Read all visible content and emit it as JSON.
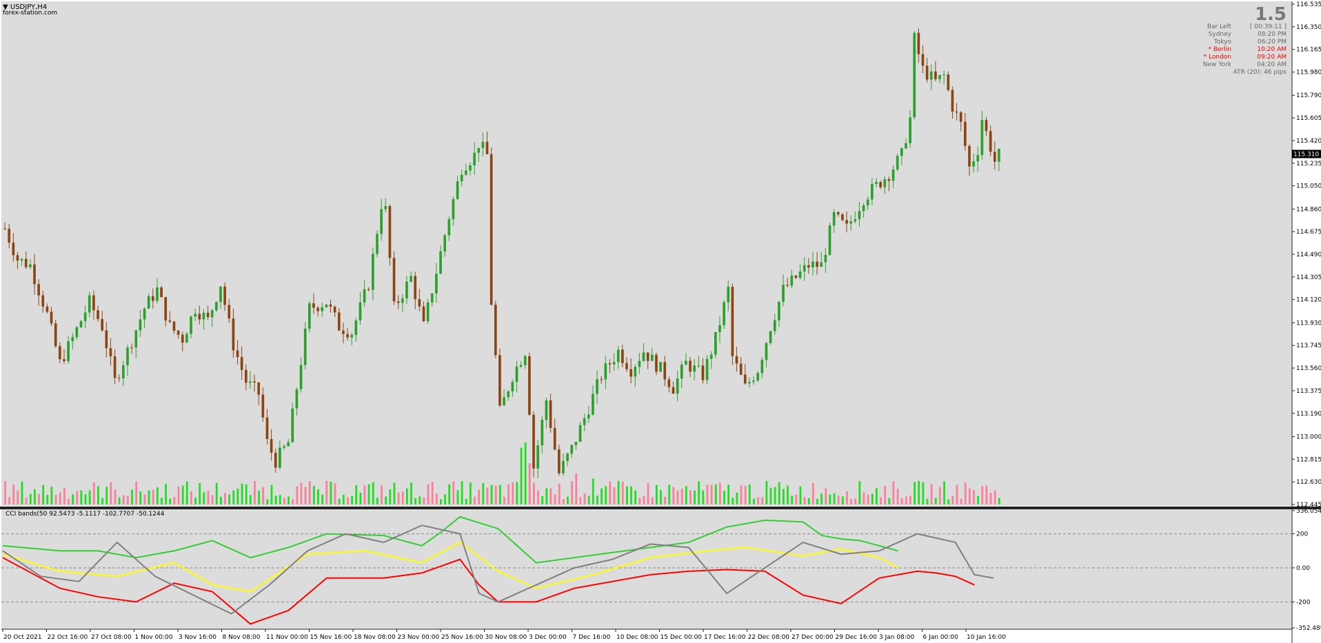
{
  "window": {
    "title": "USDJPY,H4",
    "subtitle": "forex-station.com"
  },
  "info": {
    "spread": "1.5",
    "rows": [
      {
        "label": "Bar Left",
        "value": "[ 00:39:11 ]",
        "highlight": false
      },
      {
        "label": "Sydney",
        "value": "08:20 PM",
        "highlight": false
      },
      {
        "label": "Tokyo",
        "value": "06:20 PM",
        "highlight": false
      },
      {
        "label": "* Berlin",
        "value": "10:20 AM",
        "highlight": true
      },
      {
        "label": "* London",
        "value": "09:20 AM",
        "highlight": true
      },
      {
        "label": "New York",
        "value": "04:20 AM",
        "highlight": false
      }
    ],
    "atr": "ATR (20): 46 pips"
  },
  "indicator": {
    "label": "CCI bands(50 92.5473 -5.1117 -102.7707 -50.1244"
  },
  "colors": {
    "bull": "#2ca02c",
    "bear": "#8b4513",
    "upper_band": "#32cd32",
    "lower_band": "#ff0000",
    "middle_band": "#ffff00",
    "cci": "#808080",
    "vol_up": "#00dd00",
    "vol_down": "#ff6e8c"
  },
  "chart_data": [
    {
      "type": "candlestick",
      "symbol": "USDJPY",
      "timeframe": "H4",
      "grid": false,
      "ylim": [
        112.445,
        116.535
      ],
      "y_ticks": [
        "116.535",
        "116.350",
        "116.165",
        "115.980",
        "115.790",
        "115.605",
        "115.420",
        "115.235",
        "115.050",
        "114.860",
        "114.675",
        "114.490",
        "114.305",
        "114.120",
        "113.930",
        "113.745",
        "113.560",
        "113.375",
        "113.190",
        "113.000",
        "112.815",
        "112.630",
        "112.445"
      ],
      "current_price": "115.310",
      "x_ticks": [
        "20 Oct 2021",
        "22 Oct 16:00",
        "27 Oct 08:00",
        "1 Nov 00:00",
        "3 Nov 16:00",
        "8 Nov 08:00",
        "11 Nov 00:00",
        "15 Nov 16:00",
        "18 Nov 08:00",
        "23 Nov 00:00",
        "25 Nov 16:00",
        "30 Nov 08:00",
        "3 Dec 00:00",
        "7 Dec 16:00",
        "10 Dec 08:00",
        "15 Dec 00:00",
        "17 Dec 16:00",
        "22 Dec 08:00",
        "27 Dec 00:00",
        "29 Dec 16:00",
        "3 Jan 08:00",
        "6 Jan 00:00",
        "10 Jan 16:00"
      ],
      "close_path": [
        [
          0,
          114.7
        ],
        [
          3,
          114.45
        ],
        [
          6,
          114.4
        ],
        [
          10,
          114.0
        ],
        [
          13,
          113.6
        ],
        [
          16,
          113.8
        ],
        [
          20,
          114.1
        ],
        [
          23,
          113.9
        ],
        [
          26,
          113.45
        ],
        [
          29,
          113.7
        ],
        [
          33,
          114.05
        ],
        [
          36,
          114.2
        ],
        [
          39,
          113.9
        ],
        [
          42,
          113.8
        ],
        [
          45,
          114.05
        ],
        [
          48,
          113.95
        ],
        [
          51,
          114.25
        ],
        [
          54,
          113.75
        ],
        [
          57,
          113.45
        ],
        [
          60,
          113.35
        ],
        [
          62,
          112.95
        ],
        [
          64,
          112.8
        ],
        [
          67,
          112.95
        ],
        [
          69,
          113.4
        ],
        [
          72,
          114.05
        ],
        [
          76,
          114.1
        ],
        [
          79,
          113.9
        ],
        [
          82,
          113.85
        ],
        [
          86,
          114.25
        ],
        [
          89,
          114.9
        ],
        [
          90,
          114.85
        ],
        [
          92,
          114.05
        ],
        [
          96,
          114.3
        ],
        [
          99,
          113.9
        ],
        [
          102,
          114.35
        ],
        [
          105,
          114.8
        ],
        [
          108,
          115.2
        ],
        [
          111,
          115.3
        ],
        [
          112,
          115.4
        ],
        [
          114,
          115.3
        ],
        [
          115,
          114.1
        ],
        [
          117,
          113.2
        ],
        [
          120,
          113.5
        ],
        [
          123,
          113.7
        ],
        [
          125,
          112.75
        ],
        [
          128,
          113.3
        ],
        [
          131,
          112.7
        ],
        [
          134,
          112.9
        ],
        [
          137,
          113.15
        ],
        [
          141,
          113.5
        ],
        [
          145,
          113.7
        ],
        [
          148,
          113.55
        ],
        [
          151,
          113.7
        ],
        [
          155,
          113.55
        ],
        [
          158,
          113.4
        ],
        [
          161,
          113.6
        ],
        [
          165,
          113.5
        ],
        [
          168,
          113.8
        ],
        [
          171,
          114.2
        ],
        [
          172,
          113.65
        ],
        [
          175,
          113.4
        ],
        [
          178,
          113.55
        ],
        [
          181,
          113.9
        ],
        [
          184,
          114.2
        ],
        [
          187,
          114.3
        ],
        [
          190,
          114.4
        ],
        [
          193,
          114.4
        ],
        [
          196,
          114.8
        ],
        [
          199,
          114.7
        ],
        [
          203,
          114.95
        ],
        [
          206,
          115.05
        ],
        [
          209,
          115.15
        ],
        [
          212,
          115.3
        ],
        [
          214,
          115.6
        ],
        [
          215,
          116.25
        ],
        [
          217,
          116.0
        ],
        [
          220,
          115.9
        ],
        [
          222,
          115.95
        ],
        [
          224,
          115.7
        ],
        [
          226,
          115.55
        ],
        [
          228,
          115.2
        ],
        [
          230,
          115.35
        ],
        [
          231,
          115.6
        ],
        [
          234,
          115.25
        ],
        [
          235,
          115.3
        ]
      ],
      "volume_spikes": [
        [
          122,
          0.55
        ],
        [
          123,
          0.6
        ],
        [
          124,
          0.4
        ],
        [
          135,
          0.3
        ],
        [
          139,
          0.25
        ]
      ]
    },
    {
      "type": "line",
      "name": "CCI bands",
      "params": [
        50,
        92.5473,
        -5.1117,
        -102.7707,
        -50.1244
      ],
      "ylim": [
        -352.4893,
        336.0543
      ],
      "y_ticks": [
        "336.0543",
        "200",
        "0.00",
        "-200",
        "-352.4893"
      ],
      "levels": [
        200,
        0,
        -200
      ],
      "series": [
        {
          "name": "upper",
          "points": [
            [
              0,
              130
            ],
            [
              15,
              100
            ],
            [
              25,
              100
            ],
            [
              35,
              60
            ],
            [
              45,
              100
            ],
            [
              55,
              160
            ],
            [
              65,
              60
            ],
            [
              75,
              120
            ],
            [
              85,
              200
            ],
            [
              100,
              190
            ],
            [
              110,
              130
            ],
            [
              115,
              210
            ],
            [
              120,
              300
            ],
            [
              130,
              230
            ],
            [
              140,
              30
            ],
            [
              150,
              60
            ],
            [
              160,
              90
            ],
            [
              170,
              120
            ],
            [
              180,
              150
            ],
            [
              190,
              240
            ],
            [
              200,
              280
            ],
            [
              210,
              270
            ],
            [
              215,
              190
            ],
            [
              220,
              170
            ],
            [
              225,
              160
            ],
            [
              230,
              130
            ],
            [
              235,
              100
            ]
          ]
        },
        {
          "name": "middle",
          "points": [
            [
              0,
              80
            ],
            [
              15,
              -20
            ],
            [
              30,
              -50
            ],
            [
              45,
              30
            ],
            [
              55,
              -100
            ],
            [
              65,
              -140
            ],
            [
              80,
              80
            ],
            [
              95,
              100
            ],
            [
              110,
              30
            ],
            [
              120,
              150
            ],
            [
              130,
              -20
            ],
            [
              140,
              -120
            ],
            [
              155,
              -40
            ],
            [
              170,
              60
            ],
            [
              185,
              100
            ],
            [
              195,
              120
            ],
            [
              210,
              70
            ],
            [
              220,
              110
            ],
            [
              230,
              60
            ],
            [
              235,
              0
            ]
          ]
        },
        {
          "name": "lower",
          "points": [
            [
              0,
              60
            ],
            [
              15,
              -120
            ],
            [
              25,
              -170
            ],
            [
              35,
              -200
            ],
            [
              45,
              -90
            ],
            [
              55,
              -140
            ],
            [
              65,
              -330
            ],
            [
              75,
              -250
            ],
            [
              85,
              -60
            ],
            [
              100,
              -60
            ],
            [
              110,
              -30
            ],
            [
              120,
              50
            ],
            [
              125,
              -100
            ],
            [
              130,
              -200
            ],
            [
              140,
              -200
            ],
            [
              150,
              -120
            ],
            [
              160,
              -80
            ],
            [
              170,
              -40
            ],
            [
              180,
              -20
            ],
            [
              190,
              -10
            ],
            [
              200,
              -20
            ],
            [
              210,
              -160
            ],
            [
              220,
              -210
            ],
            [
              230,
              -60
            ],
            [
              240,
              -20
            ],
            [
              245,
              -30
            ],
            [
              250,
              -50
            ],
            [
              255,
              -100
            ]
          ]
        },
        {
          "name": "cci",
          "points": [
            [
              0,
              100
            ],
            [
              10,
              -50
            ],
            [
              20,
              -80
            ],
            [
              30,
              150
            ],
            [
              40,
              -50
            ],
            [
              50,
              -160
            ],
            [
              60,
              -270
            ],
            [
              70,
              -100
            ],
            [
              80,
              100
            ],
            [
              90,
              200
            ],
            [
              100,
              150
            ],
            [
              110,
              250
            ],
            [
              120,
              200
            ],
            [
              125,
              -150
            ],
            [
              130,
              -200
            ],
            [
              140,
              -100
            ],
            [
              150,
              0
            ],
            [
              160,
              50
            ],
            [
              170,
              140
            ],
            [
              180,
              120
            ],
            [
              190,
              -150
            ],
            [
              200,
              0
            ],
            [
              210,
              150
            ],
            [
              220,
              80
            ],
            [
              230,
              100
            ],
            [
              240,
              200
            ],
            [
              250,
              150
            ],
            [
              255,
              -40
            ],
            [
              260,
              -60
            ]
          ]
        }
      ]
    }
  ]
}
